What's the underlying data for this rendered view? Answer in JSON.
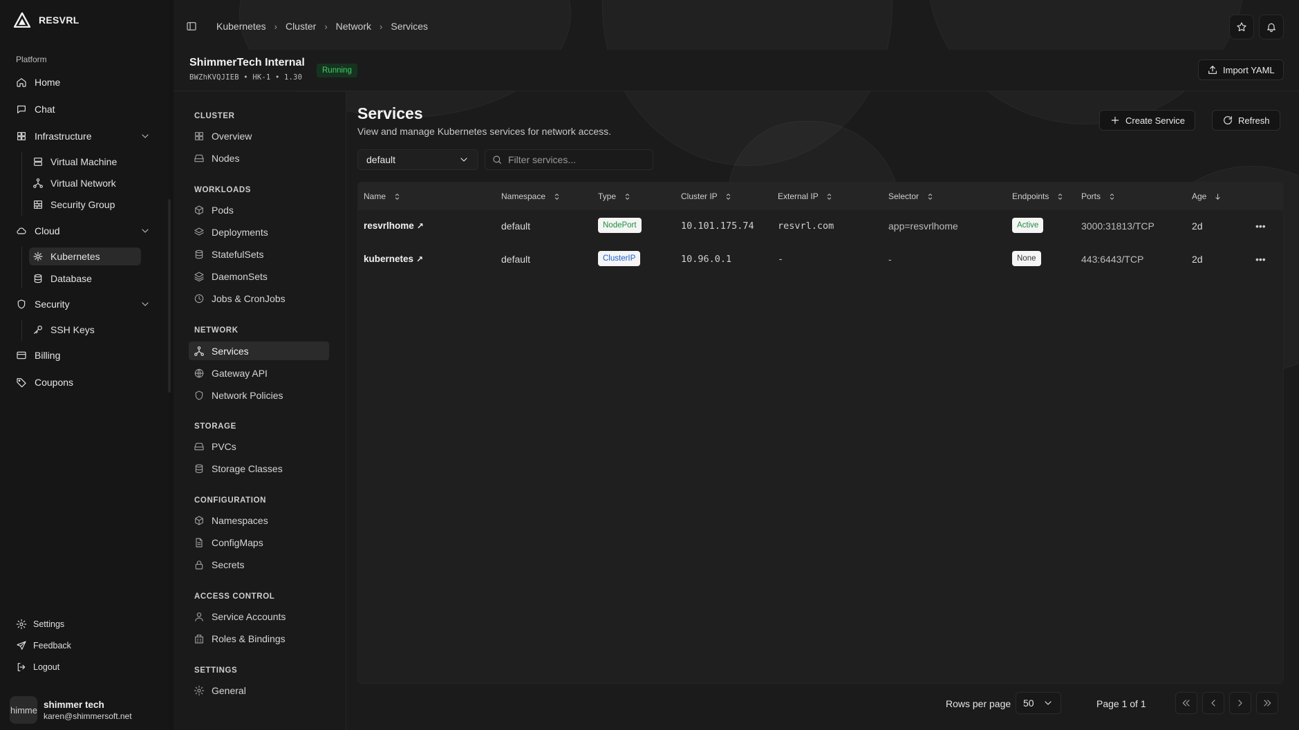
{
  "brand": {
    "name": "RESVRL"
  },
  "sidebar": {
    "section_label": "Platform",
    "items": {
      "home": "Home",
      "chat": "Chat",
      "infrastructure": "Infrastructure",
      "virtual_machine": "Virtual Machine",
      "virtual_network": "Virtual Network",
      "security_group": "Security Group",
      "cloud": "Cloud",
      "kubernetes": "Kubernetes",
      "database": "Database",
      "security": "Security",
      "ssh_keys": "SSH Keys",
      "billing": "Billing",
      "coupons": "Coupons"
    },
    "bottom": {
      "settings": "Settings",
      "feedback": "Feedback",
      "logout": "Logout"
    },
    "user": {
      "avatar_text": "himme",
      "name": "shimmer tech",
      "email": "karen@shimmersoft.net"
    }
  },
  "breadcrumb": [
    "Kubernetes",
    "Cluster",
    "Network",
    "Services"
  ],
  "cluster": {
    "title": "ShimmerTech Internal",
    "id": "BWZhKVQJIEB",
    "region": "HK-1",
    "version": "1.30",
    "status": "Running",
    "import_label": "Import YAML"
  },
  "subnav": {
    "cluster": {
      "label": "CLUSTER",
      "items": [
        "Overview",
        "Nodes"
      ]
    },
    "workloads": {
      "label": "WORKLOADS",
      "items": [
        "Pods",
        "Deployments",
        "StatefulSets",
        "DaemonSets",
        "Jobs & CronJobs"
      ]
    },
    "network": {
      "label": "NETWORK",
      "items": [
        "Services",
        "Gateway API",
        "Network Policies"
      ]
    },
    "storage": {
      "label": "STORAGE",
      "items": [
        "PVCs",
        "Storage Classes"
      ]
    },
    "configuration": {
      "label": "CONFIGURATION",
      "items": [
        "Namespaces",
        "ConfigMaps",
        "Secrets"
      ]
    },
    "access": {
      "label": "ACCESS CONTROL",
      "items": [
        "Service Accounts",
        "Roles & Bindings"
      ]
    },
    "settings": {
      "label": "SETTINGS",
      "items": [
        "General"
      ]
    }
  },
  "page": {
    "title": "Services",
    "subtitle": "View and manage Kubernetes services for network access.",
    "create_label": "Create Service",
    "refresh_label": "Refresh",
    "namespace": "default",
    "filter_placeholder": "Filter services..."
  },
  "table": {
    "columns": [
      "Name",
      "Namespace",
      "Type",
      "Cluster IP",
      "External IP",
      "Selector",
      "Endpoints",
      "Ports",
      "Age"
    ],
    "rows": [
      {
        "name": "resvrlhome",
        "namespace": "default",
        "type": "NodePort",
        "cluster_ip": "10.101.175.74",
        "external_ip": "resvrl.com",
        "selector": "app=resvrlhome",
        "endpoints": "Active",
        "ports": "3000:31813/TCP",
        "age": "2d"
      },
      {
        "name": "kubernetes",
        "namespace": "default",
        "type": "ClusterIP",
        "cluster_ip": "10.96.0.1",
        "external_ip": "-",
        "selector": "-",
        "endpoints": "None",
        "ports": "443:6443/TCP",
        "age": "2d"
      }
    ]
  },
  "pagination": {
    "rows_label": "Rows per page",
    "rows_value": "50",
    "page_label": "Page 1 of 1"
  },
  "colors": {
    "running_bg": "#16331f",
    "running_fg": "#3fd06b",
    "nodeport_fg": "#1e8f3e",
    "clusterip_fg": "#1a5fd1"
  }
}
